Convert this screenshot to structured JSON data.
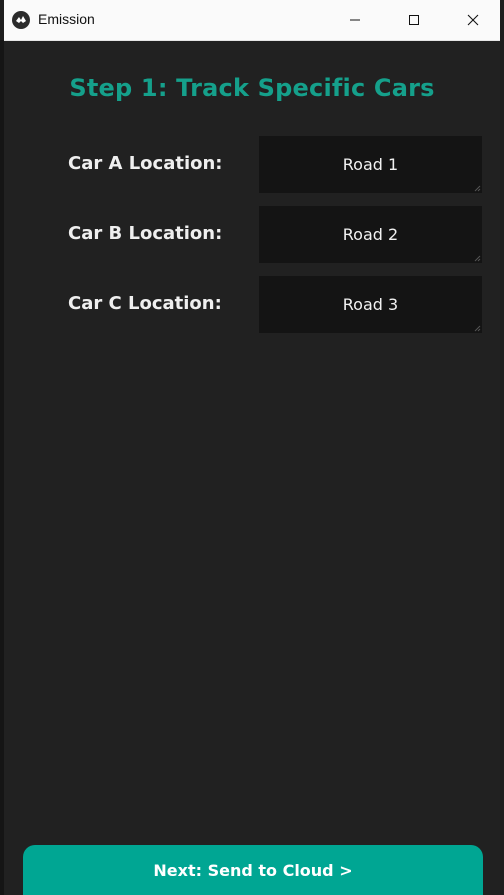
{
  "window": {
    "title": "Emission",
    "app_icon": "kivy-logo-icon",
    "controls": [
      "minimize-icon",
      "maximize-icon",
      "close-icon"
    ]
  },
  "main": {
    "step_title": "Step 1: Track Specific Cars",
    "rows": [
      {
        "label": "Car A Location:",
        "value": "Road 1"
      },
      {
        "label": "Car B Location:",
        "value": "Road 2"
      },
      {
        "label": "Car C Location:",
        "value": "Road 3"
      }
    ],
    "next_button_label": "Next: Send to Cloud >"
  },
  "colors": {
    "accent": "#15a08b",
    "button": "#00a693",
    "background": "#212121",
    "input_background": "#141414"
  }
}
